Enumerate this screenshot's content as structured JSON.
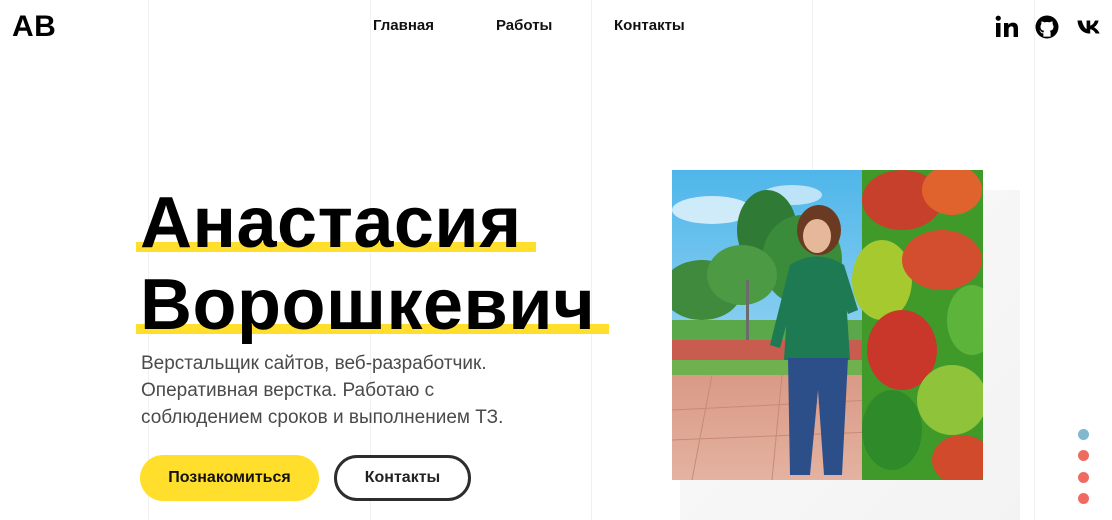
{
  "header": {
    "logo": "AB",
    "nav": [
      {
        "label": "Главная"
      },
      {
        "label": "Работы"
      },
      {
        "label": "Контакты"
      }
    ],
    "social": [
      {
        "icon": "linkedin-icon"
      },
      {
        "icon": "github-icon"
      },
      {
        "icon": "vk-icon"
      }
    ]
  },
  "hero": {
    "name_line1": "Анастасия",
    "name_line2": "Ворошкевич",
    "description": "Верстальщик сайтов, веб-разработчик. Оперативная верстка. Работаю с соблюдением сроков и выполнением ТЗ.",
    "primary_button": "Познакомиться",
    "secondary_button": "Контакты"
  },
  "pagination": {
    "count": 4,
    "active_index": 0,
    "active_color": "#7fb8cf",
    "inactive_color": "#ef6b62"
  },
  "colors": {
    "accent": "#ffdf2b",
    "text": "#000000",
    "muted": "#4a4a4a"
  }
}
